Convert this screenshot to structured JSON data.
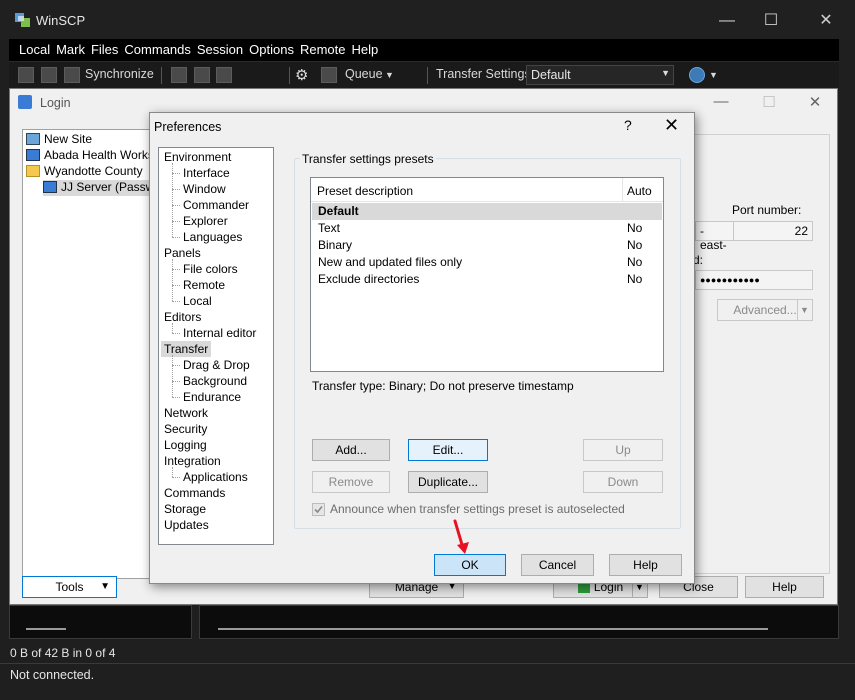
{
  "main": {
    "title": "WinSCP",
    "menu": [
      "Local",
      "Mark",
      "Files",
      "Commands",
      "Session",
      "Options",
      "Remote",
      "Help"
    ],
    "toolbar": {
      "synchronize_label": "Synchronize",
      "queue_label": "Queue",
      "transfer_settings_label": "Transfer Settings",
      "transfer_settings_value": "Default"
    },
    "status_line1": "0 B of 42 B in 0 of 4",
    "status_line2": "Not connected."
  },
  "login": {
    "title": "Login",
    "tree": [
      {
        "label": "New Site",
        "indent": 0
      },
      {
        "label": "Abada Health Workspace",
        "indent": 0
      },
      {
        "label": "Wyandotte County",
        "indent": 0
      },
      {
        "label": "JJ Server (Password)",
        "indent": 1
      }
    ],
    "host_fragment": "-east-",
    "port_label": "Port number:",
    "port_value": "22",
    "password_label_fragment": "d:",
    "password_mask": "●●●●●●●●●●●",
    "advanced_label": "Advanced...",
    "tools_label": "Tools",
    "manage_label": "Manage",
    "login_label": "Login",
    "close_label": "Close",
    "help_label": "Help"
  },
  "prefs": {
    "title": "Preferences",
    "help_glyph": "?",
    "close_glyph": "✕",
    "nav": [
      {
        "label": "Environment",
        "level": 0
      },
      {
        "label": "Interface",
        "level": 1
      },
      {
        "label": "Window",
        "level": 1
      },
      {
        "label": "Commander",
        "level": 1
      },
      {
        "label": "Explorer",
        "level": 1
      },
      {
        "label": "Languages",
        "level": 1
      },
      {
        "label": "Panels",
        "level": 0
      },
      {
        "label": "File colors",
        "level": 1
      },
      {
        "label": "Remote",
        "level": 1
      },
      {
        "label": "Local",
        "level": 1
      },
      {
        "label": "Editors",
        "level": 0
      },
      {
        "label": "Internal editor",
        "level": 1
      },
      {
        "label": "Transfer",
        "level": 0,
        "selected": true
      },
      {
        "label": "Drag & Drop",
        "level": 1
      },
      {
        "label": "Background",
        "level": 1
      },
      {
        "label": "Endurance",
        "level": 1
      },
      {
        "label": "Network",
        "level": 0
      },
      {
        "label": "Security",
        "level": 0
      },
      {
        "label": "Logging",
        "level": 0
      },
      {
        "label": "Integration",
        "level": 0
      },
      {
        "label": "Applications",
        "level": 1
      },
      {
        "label": "Commands",
        "level": 0
      },
      {
        "label": "Storage",
        "level": 0
      },
      {
        "label": "Updates",
        "level": 0
      }
    ],
    "group_title": "Transfer settings presets",
    "columns": [
      "Preset description",
      "Auto"
    ],
    "rows": [
      {
        "desc": "Default",
        "auto": "",
        "selected": true
      },
      {
        "desc": "Text",
        "auto": "No"
      },
      {
        "desc": "Binary",
        "auto": "No"
      },
      {
        "desc": "New and updated files only",
        "auto": "No"
      },
      {
        "desc": "Exclude directories",
        "auto": "No"
      }
    ],
    "transfer_type": "Transfer type: Binary; Do not preserve timestamp",
    "buttons": {
      "add": "Add...",
      "edit": "Edit...",
      "up": "Up",
      "remove": "Remove",
      "duplicate": "Duplicate...",
      "down": "Down",
      "ok": "OK",
      "cancel": "Cancel",
      "help": "Help"
    },
    "autoselect_label": "Announce when transfer settings preset is autoselected",
    "autoselect_checked": true
  },
  "colors": {
    "accent": "#0078d7",
    "annotation_arrow": "#e81123"
  }
}
